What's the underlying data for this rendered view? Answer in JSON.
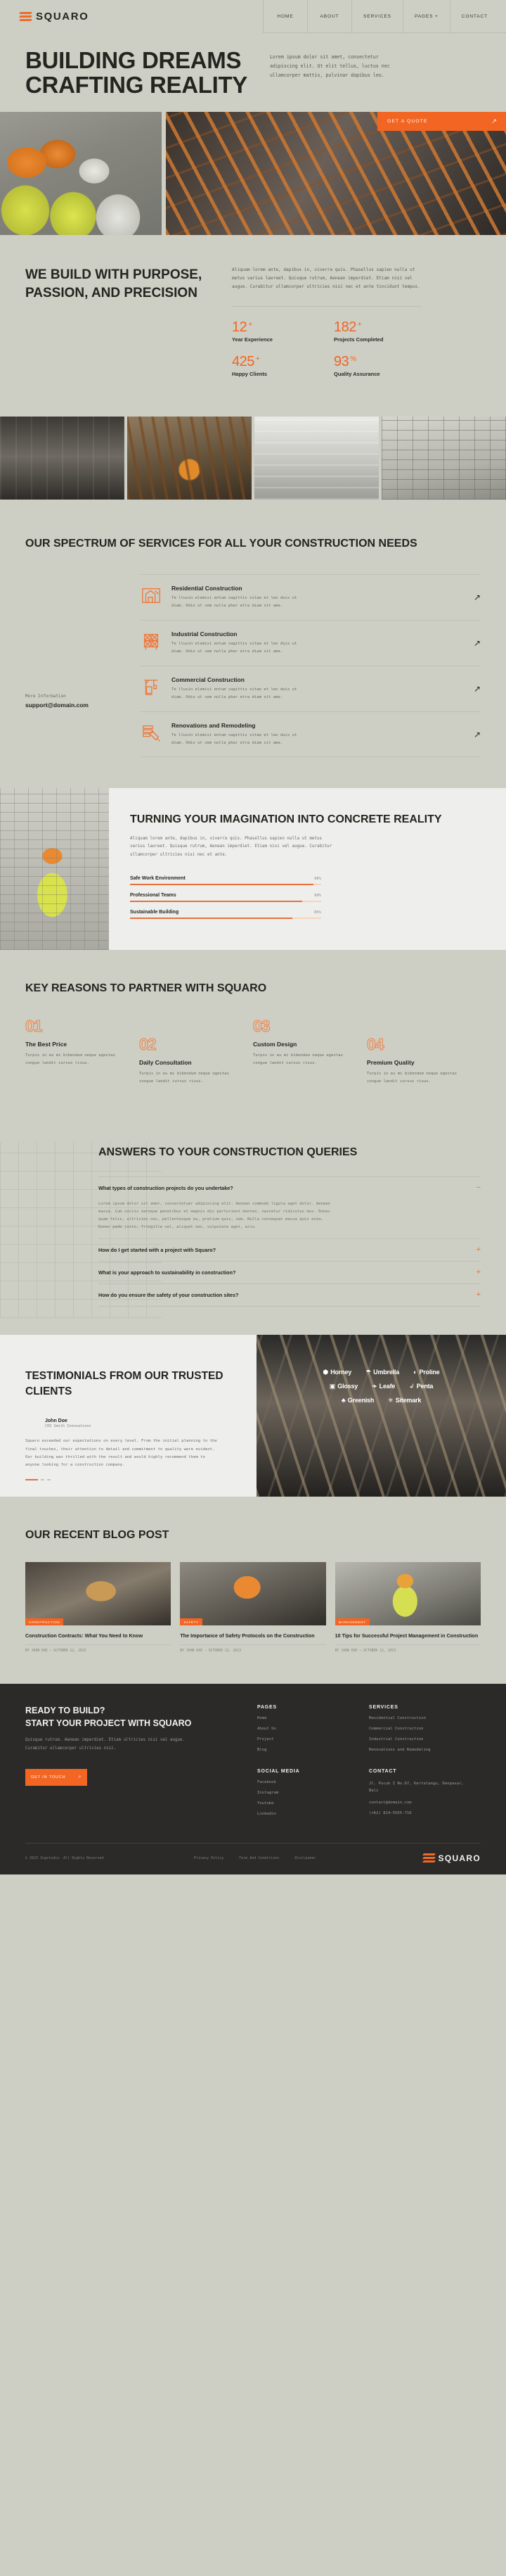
{
  "brand": {
    "name": "SQUARO",
    "logo_icon": "squaro-stripes-logo"
  },
  "nav": {
    "items": [
      {
        "label": "HOME"
      },
      {
        "label": "ABOUT"
      },
      {
        "label": "SERVICES"
      },
      {
        "label": "PAGES +"
      },
      {
        "label": "CONTACT"
      }
    ]
  },
  "hero": {
    "title_line1": "BUILDING DREAMS",
    "title_line2": "CRAFTING REALITY",
    "paragraph": "Lorem ipsum dolor sit amet, consectetur adipiscing elit. Ut elit tellus, luctus nec ullamcorper mattis, pulvinar dapibus leo.",
    "cta_label": "GET A QUOTE",
    "cta_icon": "arrow-up-right-icon"
  },
  "about": {
    "title": "WE BUILD WITH PURPOSE, PASSION, AND PRECISION",
    "paragraph": "Aliquam lorem ante, dapibus in, viverra quis. Phasellus sapien nulla ut metus varius laoreet. Quisque rutrum, Aenean imperdiet. Etiam nisi vel augue. Curabitur ullamcorper ultricies nisi nec et ante tincidunt tempus.",
    "stats": [
      {
        "value": "12",
        "suffix": "+",
        "label": "Year Experience"
      },
      {
        "value": "182",
        "suffix": "+",
        "label": "Projects Completed"
      },
      {
        "value": "425",
        "suffix": "+",
        "label": "Happy Clients"
      },
      {
        "value": "93",
        "suffix": "%",
        "label": "Quality Assurance"
      }
    ]
  },
  "services": {
    "title": "OUR SPECTRUM OF SERVICES FOR ALL YOUR CONSTRUCTION NEEDS",
    "more_label": "More Information",
    "email": "support@domain.com",
    "items": [
      {
        "name": "Residential Construction",
        "desc": "Te llusin elemisi entum sagittis vitae et leo duis ut diam. Odio ut sem nulla phar etra diam sit ame.",
        "icon": "house-blueprint-icon"
      },
      {
        "name": "Industrial Construction",
        "desc": "Te llusin elemisi entum sagittis vitae et leo duis ut diam. Odio ut sem nulla phar etra diam sit ame.",
        "icon": "steel-frame-icon"
      },
      {
        "name": "Commercial Construction",
        "desc": "Te llusin elemisi entum sagittis vitae et leo duis ut diam. Odio ut sem nulla phar etra diam sit ame.",
        "icon": "crane-icon"
      },
      {
        "name": "Renovations and Remodeling",
        "desc": "Te llusin elemisi entum sagittis vitae et leo duis ut diam. Odio ut sem nulla phar etra diam sit ame.",
        "icon": "brick-trowel-icon"
      }
    ]
  },
  "imagination": {
    "title": "TURNING YOUR IMAGINATION INTO CONCRETE REALITY",
    "paragraph": "Aliquam lorem ante, dapibus in, viverra quis. Phasellus sapien nulla ut metus varius laoreet. Quisque rutrum, Aenean imperdiet. Etiam nisi vel augue. Curabitur ullamcorper ultricies nisi nec et ante.",
    "bars": [
      {
        "label": "Safe Work Environment",
        "pct_label": "96%",
        "pct": 96
      },
      {
        "label": "Professional Teams",
        "pct_label": "90%",
        "pct": 90
      },
      {
        "label": "Sustainable Building",
        "pct_label": "85%",
        "pct": 85
      }
    ]
  },
  "reasons": {
    "title": "KEY REASONS TO PARTNER WITH SQUARO",
    "items": [
      {
        "num": "01",
        "name": "The Best Price",
        "desc": "Turpis in eu mi bibendum neque egestas congue landit cursus risus."
      },
      {
        "num": "02",
        "name": "Daily Consultation",
        "desc": "Turpis in eu mi bibendum neque egestas congue landit cursus risus."
      },
      {
        "num": "03",
        "name": "Custom Design",
        "desc": "Turpis in eu mi bibendum neque egestas congue landit cursus risus."
      },
      {
        "num": "04",
        "name": "Premium Quality",
        "desc": "Turpis in eu mi bibendum neque egestas congue landit cursus risus."
      }
    ]
  },
  "faq": {
    "title": "ANSWERS TO YOUR CONSTRUCTION QUERIES",
    "items": [
      {
        "question": "What types of construction projects do you undertake?",
        "sign": "−",
        "answer": "Lorem ipsum dolor sit amet, consectetuer adipiscing elit. Aenean commodo ligula eget dolor. Aenean massa. Cum sociis natoque penatibus et magnis dis parturient montes, nascetur ridiculus mus. Donec quam felis, ultricies nec, pellentesque eu, pretium quis, sem. Nulla consequat massa quis enim. Donec pede justo, fringilla vel, aliquet nec, vulputate eget, arcu."
      },
      {
        "question": "How do I get started with a project with Squaro?",
        "sign": "+",
        "answer": ""
      },
      {
        "question": "What is your approach to sustainability in construction?",
        "sign": "+",
        "answer": ""
      },
      {
        "question": "How do you ensure the safety of your construction sites?",
        "sign": "+",
        "answer": ""
      }
    ]
  },
  "testimonials": {
    "title": "TESTIMONIALS FROM OUR TRUSTED CLIENTS",
    "person_name": "John Doe",
    "person_role": "CEO Smith Innovations",
    "quote": "Squaro exceeded our expectations on every level. From the initial planning to the final touches, their attention to detail and commitment to quality were evident. Our building was thrilled with the result and would highly recommend them to anyone looking for a construction company.",
    "brand_logos": [
      {
        "name": "Horney",
        "icon": "hexagon-icon"
      },
      {
        "name": "Umbrella",
        "icon": "umbrella-icon"
      },
      {
        "name": "Proline",
        "icon": "circle-line-icon"
      },
      {
        "name": "Glossy",
        "icon": "square-slash-icon"
      },
      {
        "name": "Leafe",
        "icon": "leaf-icon"
      },
      {
        "name": "Penta",
        "icon": "hook-icon"
      },
      {
        "name": "Greenish",
        "icon": "sprout-icon"
      },
      {
        "name": "Sitemark",
        "icon": "asterisk-icon"
      }
    ]
  },
  "blog": {
    "title": "OUR RECENT BLOG POST",
    "posts": [
      {
        "tag": "CONSTRUCTION",
        "title": "Construction Contracts: What You Need to Know",
        "meta": "BY JOHN DOE   —   OCTOBER 12, 2023"
      },
      {
        "tag": "SAFETY",
        "title": "The Importance of Safety Protocols on the Construction",
        "meta": "BY JOHN DOE   —   OCTOBER 12, 2023"
      },
      {
        "tag": "MANAGEMENT",
        "title": "10 Tips for Successful Project Management in Construction",
        "meta": "BY JOHN DOE   —   OCTOBER 12, 2023"
      }
    ]
  },
  "footer": {
    "head_line1": "READY TO BUILD?",
    "head_line2": "START YOUR PROJECT WITH SQUARO",
    "paragraph": "Quisque rutrum. Aenean imperdiet. Etiam ultricies nisi vel augue. Curabitur ullamcorper ultricies nisi.",
    "cta_label": "GET IN TOUCH",
    "cta_icon": "arrow-up-right-icon",
    "columns": [
      {
        "heading": "PAGES",
        "links": [
          "Home",
          "About Us",
          "Project",
          "Blog"
        ]
      },
      {
        "heading": "SERVICES",
        "links": [
          "Residential Construction",
          "Commercial Construction",
          "Industrial Construction",
          "Renovations and Remodeling"
        ]
      },
      {
        "heading": "SOCIAL MEDIA",
        "links": [
          "Facebook",
          "Instagram",
          "Youtube",
          "Linkedin"
        ]
      },
      {
        "heading": "CONTACT",
        "links": [
          "Jl. Pucuk I No.67, Kertalangu, Denpasar, Bali",
          "contact@domain.com",
          "(+62) 814-5555-716"
        ]
      }
    ],
    "copyright": "© 2023 Ingstudio. All Rights Reserved",
    "bottom_links": [
      "Privacy Policy",
      "Term And Conditions",
      "Disclaimer"
    ],
    "brand": "SQUARO"
  },
  "colors": {
    "accent": "#f26522",
    "bg": "#cdcec4",
    "dark": "#2b2a28",
    "light": "#eeeeec"
  }
}
